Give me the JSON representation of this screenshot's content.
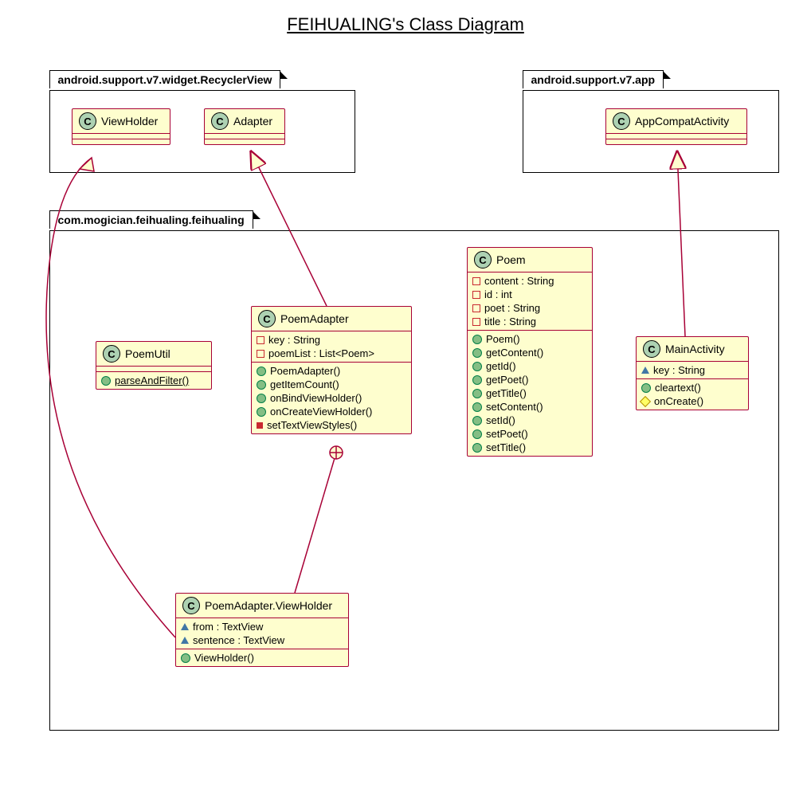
{
  "title": "FEIHUALING's Class Diagram",
  "packages": {
    "p1": "android.support.v7.widget.RecyclerView",
    "p2": "android.support.v7.app",
    "p3": "com.mogician.feihualing.feihualing"
  },
  "classes": {
    "viewholder": {
      "name": "ViewHolder"
    },
    "adapter": {
      "name": "Adapter"
    },
    "appcompat": {
      "name": "AppCompatActivity"
    },
    "poemutil": {
      "name": "PoemUtil",
      "methods": [
        {
          "vis": "pub",
          "text": "parseAndFilter()",
          "static": true
        }
      ]
    },
    "poemadapter": {
      "name": "PoemAdapter",
      "attrs": [
        {
          "vis": "priv",
          "text": "key : String"
        },
        {
          "vis": "priv",
          "text": "poemList : List<Poem>"
        }
      ],
      "methods": [
        {
          "vis": "pub",
          "text": "PoemAdapter()"
        },
        {
          "vis": "pub",
          "text": "getItemCount()"
        },
        {
          "vis": "pub",
          "text": "onBindViewHolder()"
        },
        {
          "vis": "pub",
          "text": "onCreateViewHolder()"
        },
        {
          "vis": "priv-s",
          "text": "setTextViewStyles()"
        }
      ]
    },
    "poem": {
      "name": "Poem",
      "attrs": [
        {
          "vis": "priv",
          "text": "content : String"
        },
        {
          "vis": "priv",
          "text": "id : int"
        },
        {
          "vis": "priv",
          "text": "poet : String"
        },
        {
          "vis": "priv",
          "text": "title : String"
        }
      ],
      "methods": [
        {
          "vis": "pub",
          "text": "Poem()"
        },
        {
          "vis": "pub",
          "text": "getContent()"
        },
        {
          "vis": "pub",
          "text": "getId()"
        },
        {
          "vis": "pub",
          "text": "getPoet()"
        },
        {
          "vis": "pub",
          "text": "getTitle()"
        },
        {
          "vis": "pub",
          "text": "setContent()"
        },
        {
          "vis": "pub",
          "text": "setId()"
        },
        {
          "vis": "pub",
          "text": "setPoet()"
        },
        {
          "vis": "pub",
          "text": "setTitle()"
        }
      ]
    },
    "mainactivity": {
      "name": "MainActivity",
      "attrs": [
        {
          "vis": "pkg",
          "text": "key : String"
        }
      ],
      "methods": [
        {
          "vis": "pub",
          "text": "cleartext()"
        },
        {
          "vis": "prot",
          "text": "onCreate()"
        }
      ]
    },
    "pavh": {
      "name": "PoemAdapter.ViewHolder",
      "attrs": [
        {
          "vis": "pkg",
          "text": "from : TextView"
        },
        {
          "vis": "pkg",
          "text": "sentence : TextView"
        }
      ],
      "methods": [
        {
          "vis": "pub",
          "text": "ViewHolder()"
        }
      ]
    }
  }
}
